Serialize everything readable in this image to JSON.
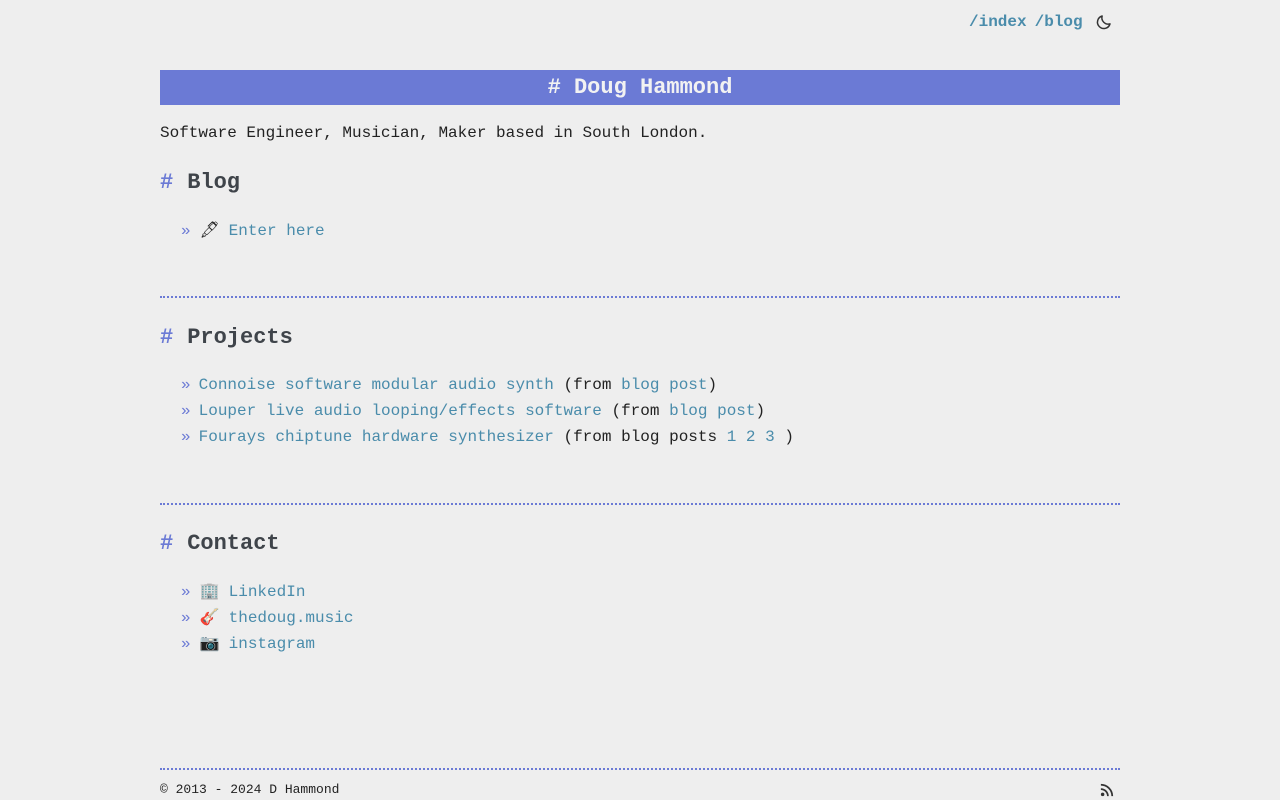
{
  "nav": {
    "links": [
      "/index",
      "/blog"
    ],
    "theme_toggle_icon": "moon-icon"
  },
  "header": {
    "title": "# Doug Hammond"
  },
  "intro": "Software Engineer, Musician, Maker based in South London.",
  "blog": {
    "title": "Blog",
    "items": [
      {
        "emoji": "🖋",
        "icon": "pen-icon",
        "link": "Enter here"
      }
    ]
  },
  "projects": {
    "title": "Projects",
    "items": [
      {
        "link": "Connoise software modular audio synth",
        "pre": " (from ",
        "post_link": "blog post",
        "end": ")"
      },
      {
        "link": "Louper live audio looping/effects software",
        "pre": " (from ",
        "post_link": "blog post",
        "end": ")"
      },
      {
        "link": "Fourays chiptune hardware synthesizer",
        "pre": " (from blog posts ",
        "nums": [
          "1",
          "2",
          "3"
        ],
        "end": " )"
      }
    ]
  },
  "contact": {
    "title": "Contact",
    "items": [
      {
        "emoji": "🏢",
        "icon": "office-building-icon",
        "link": "LinkedIn"
      },
      {
        "emoji": "🎸",
        "icon": "guitar-icon",
        "link": "thedoug.music"
      },
      {
        "emoji": "📷",
        "icon": "camera-icon",
        "link": "instagram"
      }
    ]
  },
  "footer": {
    "copyright": "© 2013 - 2024 D Hammond",
    "rss_icon": "rss-icon"
  },
  "colors": {
    "accent": "#6b7ad5",
    "link": "#4a8cab",
    "background": "#eeeeee",
    "heading": "#3f444a"
  }
}
